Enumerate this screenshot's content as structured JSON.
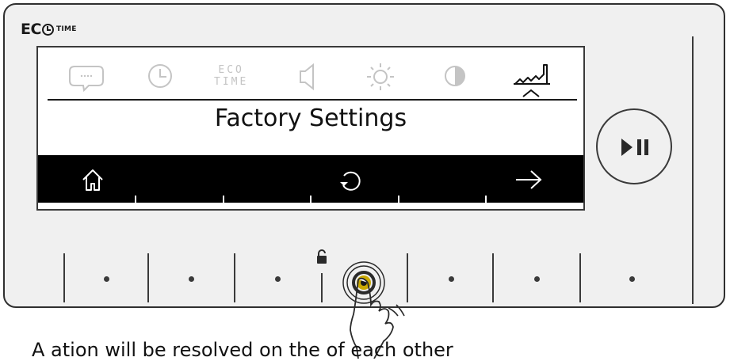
{
  "logo": {
    "eco": "EC",
    "time": "TIME",
    "clock_icon": "clock-icon"
  },
  "screen": {
    "icons": [
      {
        "name": "chat-icon",
        "active": false
      },
      {
        "name": "clock-icon",
        "active": false
      },
      {
        "name": "eco-time-icon",
        "active": false,
        "line1": "ECO",
        "line2": "TIME"
      },
      {
        "name": "speaker-icon",
        "active": false
      },
      {
        "name": "brightness-icon",
        "active": false
      },
      {
        "name": "contrast-icon",
        "active": false
      },
      {
        "name": "factory-icon",
        "active": true
      }
    ],
    "title": "Factory Settings",
    "bottom_bar": {
      "left": "home-icon",
      "center": "reset-icon",
      "right": "arrow-right-icon"
    }
  },
  "play_pause_button": "play-pause-icon",
  "lock_icon": "padlock-icon",
  "caption": "A     ation will be resolved on the            of each other",
  "colors": {
    "panel": "#f0f0f0",
    "border": "#3a3a3a",
    "inactive_icon": "#c4c4c4",
    "active_touch": "#c9a800"
  }
}
